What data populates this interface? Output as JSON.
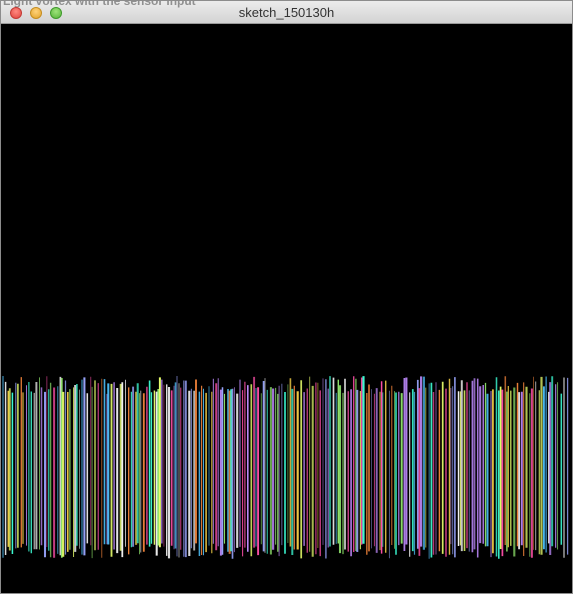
{
  "window": {
    "title": "sketch_150130h",
    "behind_text": "Light vortex with the sensor input"
  },
  "controls": {
    "close": "close-button",
    "minimize": "minimize-button",
    "zoom": "zoom-button"
  },
  "colors": {
    "canvas_background": "#000000",
    "line_palette": [
      "#ff4fa8",
      "#8fe36b",
      "#4fc4ff",
      "#ffd84a",
      "#c08bff",
      "#ff8a3d",
      "#3dffd7",
      "#f2f2f2",
      "#9aa6ff",
      "#e8ff6b"
    ]
  }
}
